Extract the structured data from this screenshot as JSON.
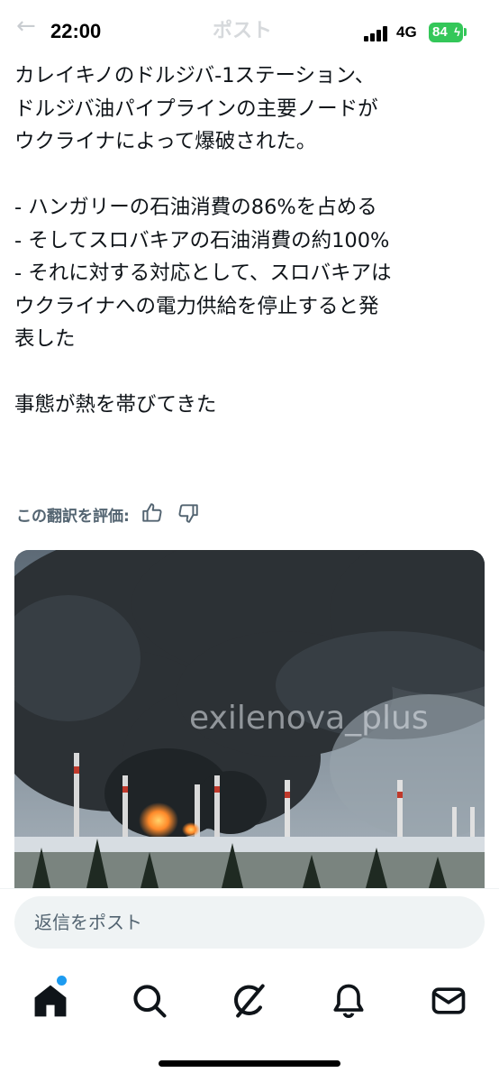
{
  "status_bar": {
    "time": "22:00",
    "network": "4G",
    "battery": "84"
  },
  "header": {
    "title": "ポスト"
  },
  "post": {
    "lines": [
      "カレイキノのドルジバ-1ステーション、",
      "ドルジバ油パイプラインの主要ノードが",
      "ウクライナによって爆破された。",
      "",
      "- ハンガリーの石油消費の86%を占める",
      "- そしてスロバキアの石油消費の約100%",
      "- それに対する対応として、スロバキアは",
      "ウクライナへの電力供給を停止すると発",
      "表した",
      "",
      "事態が熱を帯びてきた"
    ]
  },
  "translation": {
    "rate_label": "この翻訳を評価:"
  },
  "media": {
    "watermark": "exilenova_plus"
  },
  "reply": {
    "placeholder": "返信をポスト"
  },
  "tabs": [
    {
      "name": "home",
      "icon": "home-icon",
      "active": true,
      "badge_dot": true
    },
    {
      "name": "search",
      "icon": "search-icon"
    },
    {
      "name": "grok",
      "icon": "grok-icon"
    },
    {
      "name": "notifications",
      "icon": "bell-icon"
    },
    {
      "name": "messages",
      "icon": "mail-icon"
    }
  ],
  "colors": {
    "accent": "#1d9bf0",
    "battery": "#34c759",
    "muted_text": "#536471"
  }
}
